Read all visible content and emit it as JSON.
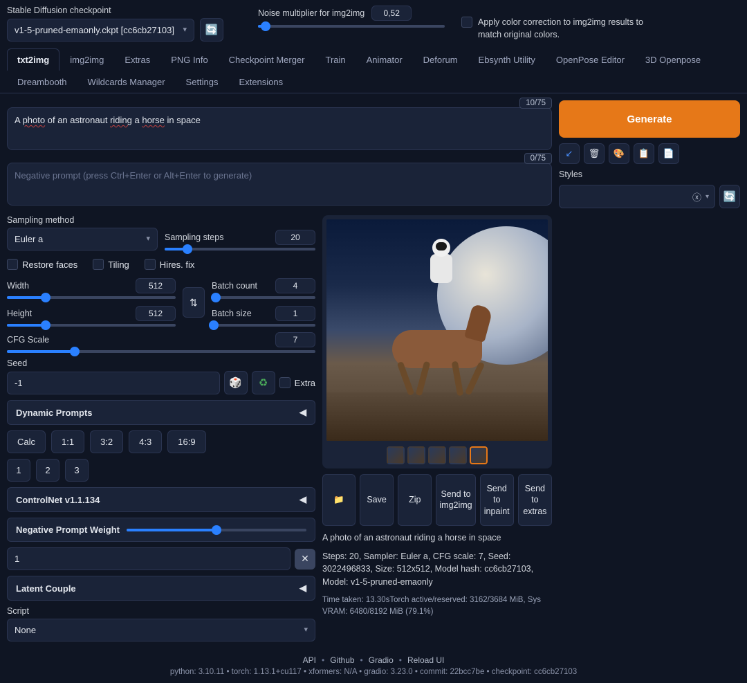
{
  "header": {
    "checkpoint_label": "Stable Diffusion checkpoint",
    "checkpoint_value": "v1-5-pruned-emaonly.ckpt [cc6cb27103]",
    "noise_label": "Noise multiplier for img2img",
    "noise_value": "0,52",
    "color_correction": "Apply color correction to img2img results to match original colors."
  },
  "tabs": [
    "txt2img",
    "img2img",
    "Extras",
    "PNG Info",
    "Checkpoint Merger",
    "Train",
    "Animator",
    "Deforum",
    "Ebsynth Utility",
    "OpenPose Editor",
    "3D Openpose",
    "Dreambooth",
    "Wildcards Manager",
    "Settings",
    "Extensions"
  ],
  "active_tab": "txt2img",
  "prompt": {
    "counter": "10/75",
    "text_parts": [
      "A ",
      "photo",
      " of an astronaut ",
      "riding",
      " a ",
      "horse",
      " in space"
    ],
    "neg_counter": "0/75",
    "neg_placeholder": "Negative prompt (press Ctrl+Enter or Alt+Enter to generate)"
  },
  "generate": "Generate",
  "styles_label": "Styles",
  "settings": {
    "sampling_method_label": "Sampling method",
    "sampling_method": "Euler a",
    "sampling_steps_label": "Sampling steps",
    "sampling_steps": "20",
    "restore_faces": "Restore faces",
    "tiling": "Tiling",
    "hires_fix": "Hires. fix",
    "width_label": "Width",
    "width": "512",
    "height_label": "Height",
    "height": "512",
    "batch_count_label": "Batch count",
    "batch_count": "4",
    "batch_size_label": "Batch size",
    "batch_size": "1",
    "cfg_label": "CFG Scale",
    "cfg": "7",
    "seed_label": "Seed",
    "seed": "-1",
    "extra": "Extra",
    "dynamic_prompts": "Dynamic Prompts",
    "ratios": [
      "Calc",
      "1:1",
      "3:2",
      "4:3",
      "16:9"
    ],
    "pages": [
      "1",
      "2",
      "3"
    ],
    "controlnet": "ControlNet v1.1.134",
    "npw_label": "Negative Prompt Weight",
    "npw_value": "1",
    "latent_couple": "Latent Couple",
    "script_label": "Script",
    "script": "None"
  },
  "output": {
    "save": "Save",
    "zip": "Zip",
    "send_img2img": "Send to img2img",
    "send_inpaint": "Send to inpaint",
    "send_extras": "Send to extras",
    "caption": "A photo of an astronaut riding a horse in space",
    "meta": "Steps: 20, Sampler: Euler a, CFG scale: 7, Seed: 3022496833, Size: 512x512, Model hash: cc6cb27103, Model: v1-5-pruned-emaonly",
    "time": "Time taken: 13.30sTorch active/reserved: 3162/3684 MiB, Sys VRAM: 6480/8192 MiB (79.1%)"
  },
  "footer": {
    "links": [
      "API",
      "Github",
      "Gradio",
      "Reload UI"
    ],
    "versions": "python: 3.10.11  •  torch: 1.13.1+cu117  •  xformers: N/A  •  gradio: 3.23.0  •  commit: 22bcc7be  •  checkpoint: cc6cb27103"
  }
}
